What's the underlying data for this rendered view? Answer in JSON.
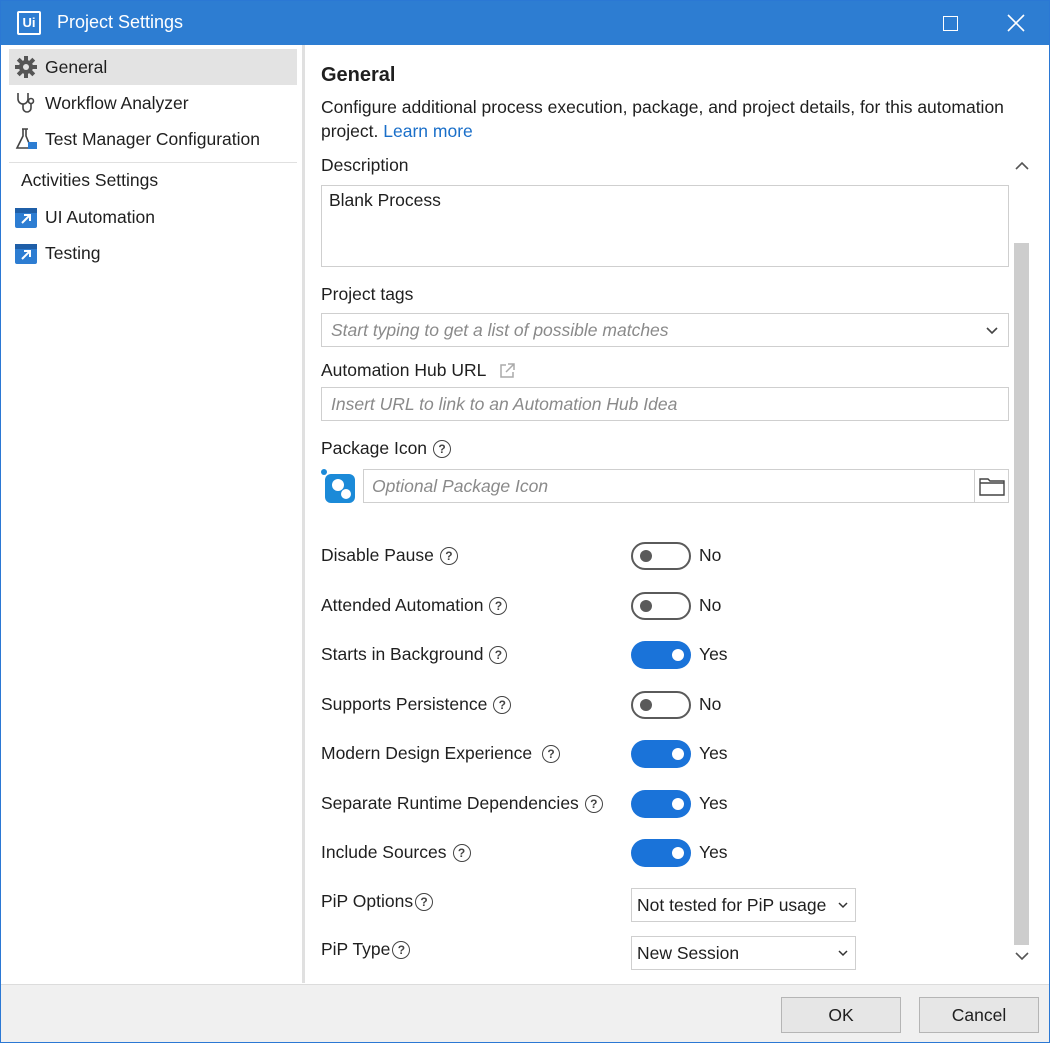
{
  "window": {
    "title": "Project Settings",
    "logo_text": "Ui"
  },
  "sidebar": {
    "items": [
      {
        "label": "General",
        "icon": "gear-icon"
      },
      {
        "label": "Workflow Analyzer",
        "icon": "stethoscope-icon"
      },
      {
        "label": "Test Manager Configuration",
        "icon": "flask-icon"
      }
    ],
    "activities_heading": "Activities Settings",
    "activities": [
      {
        "label": "UI Automation",
        "icon": "activity-package-icon"
      },
      {
        "label": "Testing",
        "icon": "activity-package-icon"
      }
    ]
  },
  "general": {
    "title": "General",
    "description_text": "Configure additional process execution, package, and project details, for this automation project.",
    "learn_more": "Learn more",
    "description_label": "Description",
    "description_value": "Blank Process",
    "tags_label": "Project tags",
    "tags_placeholder": "Start typing to get a list of possible matches",
    "hub_label": "Automation Hub URL",
    "hub_placeholder": "Insert URL to link to an Automation Hub Idea",
    "package_icon_label": "Package Icon",
    "package_icon_placeholder": "Optional Package Icon",
    "toggles": [
      {
        "label": "Disable Pause",
        "value": "No",
        "on": false
      },
      {
        "label": "Attended Automation",
        "value": "No",
        "on": false
      },
      {
        "label": "Starts in Background",
        "value": "Yes",
        "on": true
      },
      {
        "label": "Supports Persistence",
        "value": "No",
        "on": false
      },
      {
        "label": "Modern Design Experience",
        "value": "Yes",
        "on": true
      },
      {
        "label": "Separate Runtime Dependencies",
        "value": "Yes",
        "on": true
      },
      {
        "label": "Include Sources",
        "value": "Yes",
        "on": true
      }
    ],
    "pip_options_label": "PiP Options",
    "pip_options_value": "Not tested for PiP usage",
    "pip_type_label": "PiP Type",
    "pip_type_value": "New Session"
  },
  "footer": {
    "ok": "OK",
    "cancel": "Cancel"
  },
  "colors": {
    "accent": "#2d7dd2",
    "toggle_on": "#1a73d9",
    "link": "#1a6fc9"
  }
}
